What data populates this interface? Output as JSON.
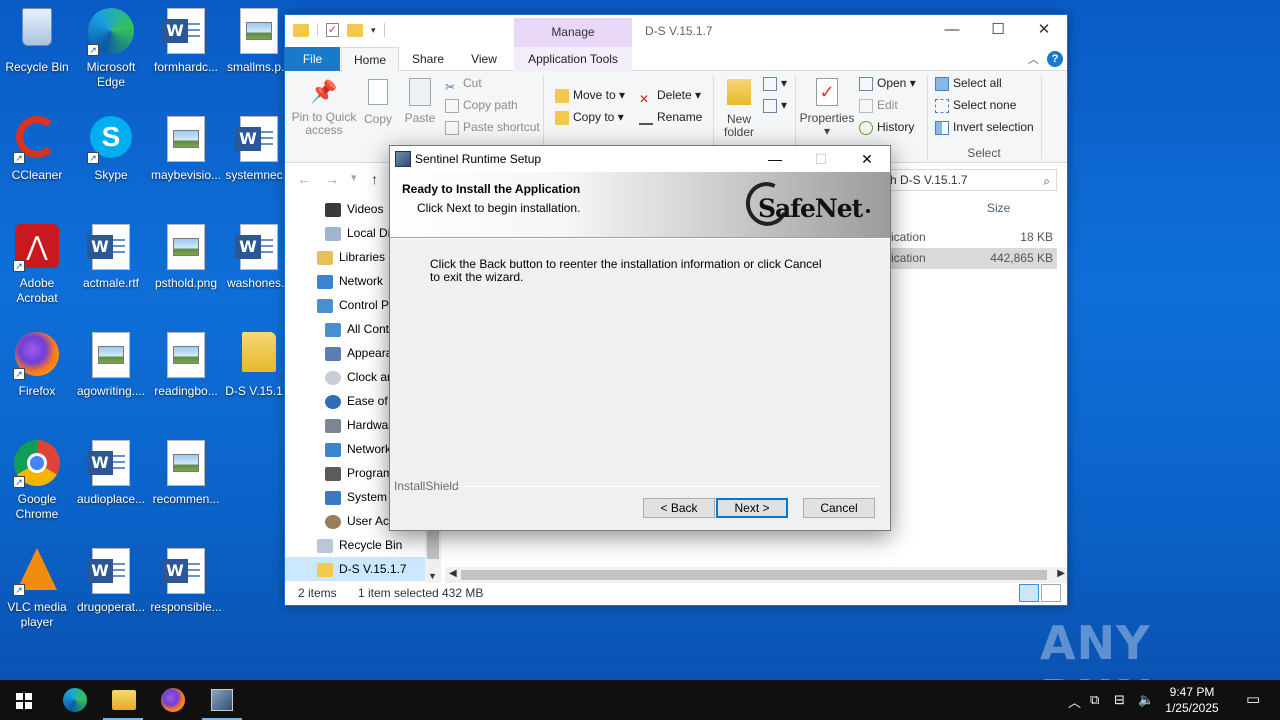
{
  "desktop": {
    "icons": [
      {
        "label": "Recycle Bin"
      },
      {
        "label": "Microsoft Edge"
      },
      {
        "label": "formhardc..."
      },
      {
        "label": "smallms.p..."
      },
      {
        "label": "CCleaner"
      },
      {
        "label": "Skype"
      },
      {
        "label": "maybevisio..."
      },
      {
        "label": "systemnec..."
      },
      {
        "label": "Adobe Acrobat"
      },
      {
        "label": "actmale.rtf"
      },
      {
        "label": "psthold.png"
      },
      {
        "label": "washones..."
      },
      {
        "label": "Firefox"
      },
      {
        "label": "agowriting...."
      },
      {
        "label": "readingbo..."
      },
      {
        "label": "D-S V.15.1..."
      },
      {
        "label": "Google Chrome"
      },
      {
        "label": "audioplace..."
      },
      {
        "label": "recommen..."
      },
      {
        "label": "VLC media player"
      },
      {
        "label": "drugoperat..."
      },
      {
        "label": "responsible..."
      }
    ]
  },
  "explorer": {
    "title": "D-S V.15.1.7",
    "manage_label": "Manage",
    "tabs": {
      "file": "File",
      "home": "Home",
      "share": "Share",
      "view": "View",
      "app_tools": "Application Tools"
    },
    "ribbon": {
      "pin": "Pin to Quick access",
      "copy": "Copy",
      "paste": "Paste",
      "cut": "Cut",
      "copy_path": "Copy path",
      "paste_shortcut": "Paste shortcut",
      "move_to": "Move to",
      "copy_to": "Copy to",
      "delete": "Delete",
      "rename": "Rename",
      "new_folder": "New folder",
      "properties": "Properties",
      "open": "Open",
      "edit": "Edit",
      "history": "History",
      "select_all": "Select all",
      "select_none": "Select none",
      "invert_selection": "Invert selection",
      "select_group": "Select"
    },
    "search_text": "h D-S V.15.1.7",
    "nav_items": [
      {
        "label": "Videos"
      },
      {
        "label": "Local Dis"
      },
      {
        "label": "Libraries"
      },
      {
        "label": "Network"
      },
      {
        "label": "Control Pa"
      },
      {
        "label": "All Contr"
      },
      {
        "label": "Appeara"
      },
      {
        "label": "Clock an"
      },
      {
        "label": "Ease of A"
      },
      {
        "label": "Hardwar"
      },
      {
        "label": "Network"
      },
      {
        "label": "Program"
      },
      {
        "label": "System a"
      },
      {
        "label": "User Acc"
      },
      {
        "label": "Recycle Bin"
      },
      {
        "label": "D-S V.15.1.7"
      }
    ],
    "columns": {
      "size": "Size"
    },
    "files": [
      {
        "type": "ication",
        "size": "18 KB"
      },
      {
        "type": "ication",
        "size": "442,865 KB"
      }
    ],
    "status": {
      "items": "2 items",
      "selected": "1 item selected",
      "size": "432 MB"
    }
  },
  "setup": {
    "title": "Sentinel Runtime Setup",
    "heading": "Ready to Install the Application",
    "subheading": "Click Next to begin installation.",
    "logo": "SafeNet",
    "body": "Click the Back button to reenter the installation information or click Cancel to exit the wizard.",
    "installshield": "InstallShield",
    "back": "< Back",
    "next": "Next >",
    "cancel": "Cancel"
  },
  "watermark": "ANY RUN",
  "taskbar": {
    "time": "9:47 PM",
    "date": "1/25/2025"
  }
}
